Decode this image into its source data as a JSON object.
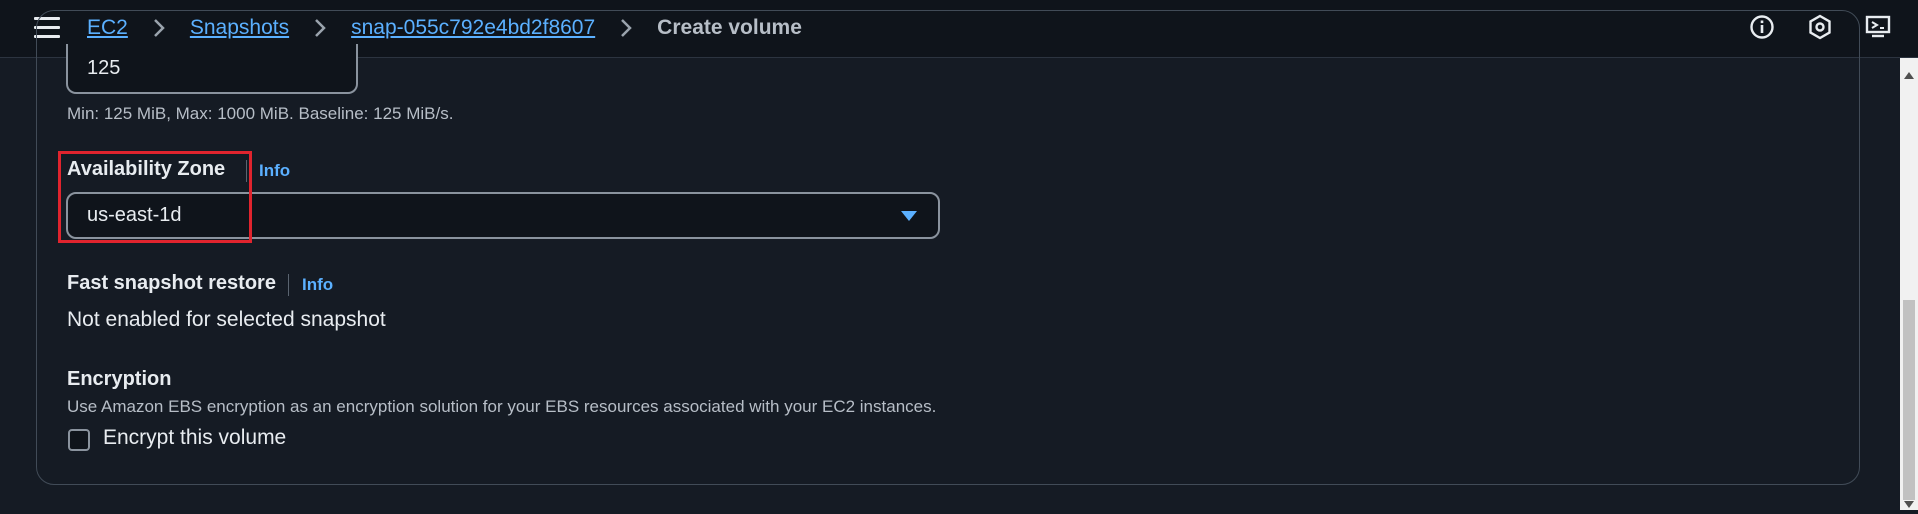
{
  "header": {
    "breadcrumb": [
      "EC2",
      "Snapshots",
      "snap-055c792e4bd2f8607"
    ],
    "current": "Create volume",
    "icons": [
      "info-circle-icon",
      "settings-hexagon-icon",
      "feedback-icon"
    ]
  },
  "throughput": {
    "value": "125",
    "hint": "Min: 125 MiB, Max: 1000 MiB. Baseline: 125 MiB/s."
  },
  "availability_zone": {
    "label": "Availability Zone",
    "info": "Info",
    "selected": "us-east-1d"
  },
  "fast_snapshot_restore": {
    "label": "Fast snapshot restore",
    "info": "Info",
    "status": "Not enabled for selected snapshot"
  },
  "encryption": {
    "label": "Encryption",
    "description": "Use Amazon EBS encryption as an encryption solution for your EBS resources associated with your EC2 instances.",
    "checkbox_label": "Encrypt this volume",
    "checked": false
  },
  "colors": {
    "background": "#151b24",
    "link": "#5bb0ff",
    "highlight": "#e0242e"
  }
}
